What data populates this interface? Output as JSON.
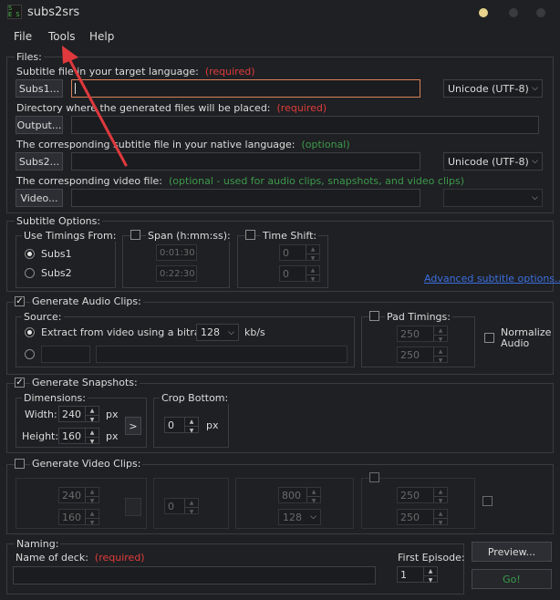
{
  "window": {
    "title": "subs2srs"
  },
  "menu": {
    "file": "File",
    "tools": "Tools",
    "help": "Help"
  },
  "files": {
    "legend": "Files:",
    "subs1_prompt": "Subtitle file in your target language:",
    "subs1_note": "(required)",
    "subs1_button": "Subs1...",
    "subs1_encoding": "Unicode (UTF-8)",
    "output_prompt": "Directory where the generated files will be placed:",
    "output_note": "(required)",
    "output_button": "Output...",
    "subs2_prompt": "The corresponding subtitle file in your native language:",
    "subs2_note": "(optional)",
    "subs2_button": "Subs2...",
    "subs2_encoding": "Unicode (UTF-8)",
    "video_prompt": "The corresponding video file:",
    "video_note": "(optional - used for audio clips, snapshots, and video clips)",
    "video_button": "Video..."
  },
  "subtitle_options": {
    "legend": "Subtitle Options:",
    "use_timings": "Use Timings From:",
    "subs1": "Subs1",
    "subs2": "Subs2",
    "span": "Span (h:mm:ss):",
    "span_start": "0:01:30",
    "span_end": "0:22:30",
    "time_shift": "Time Shift:",
    "shift1": "0",
    "shift2": "0",
    "advanced": "Advanced subtitle options..."
  },
  "audio": {
    "legend": "Generate Audio Clips:",
    "source": "Source:",
    "extract": "Extract from video using a bitrate of",
    "bitrate": "128",
    "unit": "kb/s",
    "pad_timings": "Pad Timings:",
    "pad1": "250",
    "pad2": "250",
    "normalize": "Normalize Audio"
  },
  "snapshots": {
    "legend": "Generate Snapshots:",
    "dimensions": "Dimensions:",
    "width_label": "Width:",
    "width": "240",
    "height_label": "Height:",
    "height": "160",
    "px": "px",
    "arrow_btn": ">",
    "crop_bottom": "Crop Bottom:",
    "crop": "0"
  },
  "video_clips": {
    "legend": "Generate Video Clips:",
    "w": "240",
    "h": "160",
    "crop": "0",
    "bitrate": "800",
    "audio_bitrate": "128",
    "pad1": "250",
    "pad2": "250"
  },
  "naming": {
    "legend": "Naming:",
    "deck_label": "Name of deck:",
    "deck_note": "(required)",
    "first_episode": "First Episode:",
    "episode": "1",
    "preview": "Preview...",
    "go": "Go!"
  },
  "colors": {
    "accent_red": "#e03c3c",
    "optional_green": "#3c9a4c",
    "link_blue": "#3b6fe0"
  }
}
